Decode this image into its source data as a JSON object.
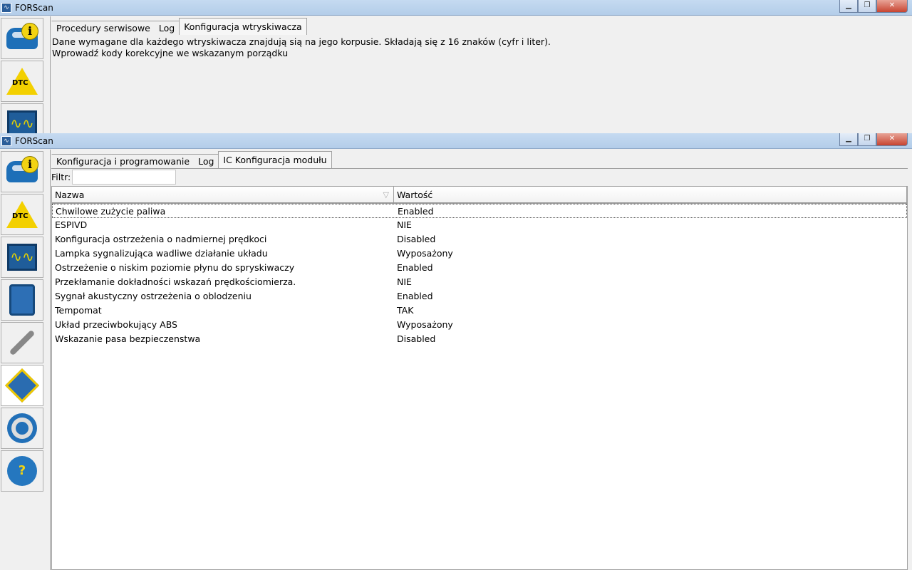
{
  "window1": {
    "title": "FORScan",
    "tabs": [
      "Procedury serwisowe",
      "Log",
      "Konfiguracja wtryskiwacza"
    ],
    "desc1": "Dane wymagane dla każdego wtryskiwacza znajdują sią na jego korpusie. Składają się z 16 znaków (cyfr i liter).",
    "desc2": "Wprowadź kody korekcyjne we wskazanym porządku"
  },
  "window2": {
    "title": "FORScan",
    "tabs": [
      "Konfiguracja i programowanie",
      "Log",
      "IC Konfiguracja modułu"
    ],
    "filter_label": "Filtr:",
    "filter_value": "",
    "columns": [
      "Nazwa",
      "Wartość"
    ],
    "rows": [
      [
        "Chwilowe zużycie paliwa",
        "Enabled"
      ],
      [
        "ESPIVD",
        "NIE"
      ],
      [
        "Konfiguracja ostrzeżenia o nadmiernej prędkoci",
        "Disabled"
      ],
      [
        "Lampka sygnalizująca wadliwe działanie układu",
        "Wyposażony"
      ],
      [
        "Ostrzeżenie o niskim poziomie płynu do spryskiwaczy",
        "Enabled"
      ],
      [
        "Przekłamanie dokładności wskazań prędkościomierza.",
        "NIE"
      ],
      [
        "Sygnał akustyczny ostrzeżenia o oblodzeniu",
        "Enabled"
      ],
      [
        "Tempomat",
        "TAK"
      ],
      [
        "Układ przeciwbokujący ABS",
        "Wyposażony"
      ],
      [
        "Wskazanie pasa bezpieczenstwa",
        "Disabled"
      ]
    ]
  },
  "icons": {
    "dtc_label": "DTC",
    "help_label": "?"
  }
}
